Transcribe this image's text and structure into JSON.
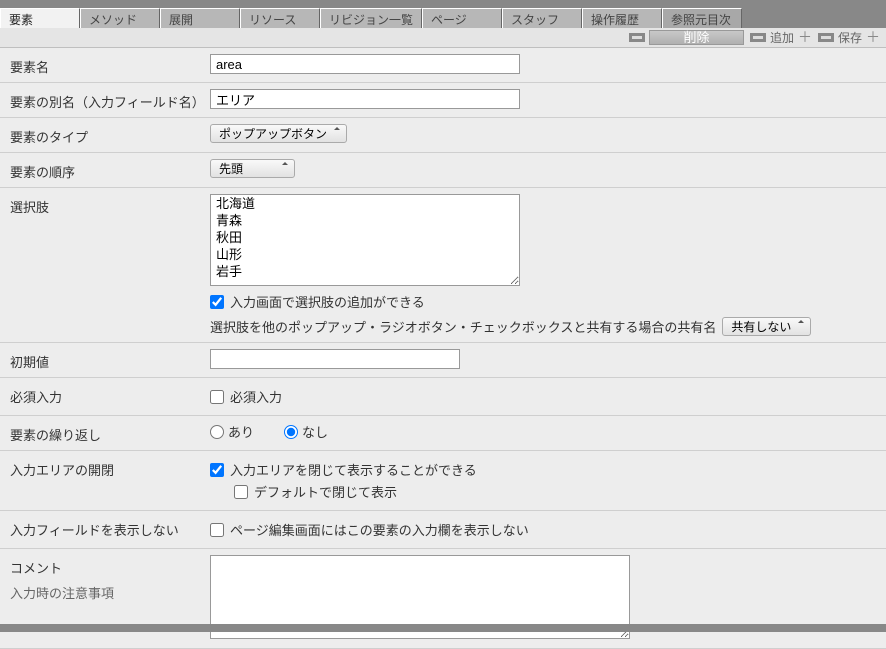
{
  "tabs": [
    {
      "label": "要素",
      "active": true
    },
    {
      "label": "メソッド"
    },
    {
      "label": "展開"
    },
    {
      "label": "リソース"
    },
    {
      "label": "リビジョン一覧"
    },
    {
      "label": "ページ"
    },
    {
      "label": "スタッフ"
    },
    {
      "label": "操作履歴"
    },
    {
      "label": "参照元目次",
      "meta": true
    }
  ],
  "toolbar": {
    "delete": "削除",
    "add": "追加",
    "save": "保存"
  },
  "fields": {
    "name": {
      "label": "要素名",
      "value": "area"
    },
    "alias": {
      "label": "要素の別名（入力フィールド名）",
      "value": "エリア"
    },
    "type": {
      "label": "要素のタイプ",
      "value": "ポップアップボタン"
    },
    "order": {
      "label": "要素の順序",
      "value": "先頭"
    },
    "choices": {
      "label": "選択肢",
      "value": "北海道\n青森\n秋田\n山形\n岩手"
    },
    "choices_add": {
      "checked": true,
      "text": "入力画面で選択肢の追加ができる"
    },
    "choices_share": {
      "text": "選択肢を他のポップアップ・ラジオボタン・チェックボックスと共有する場合の共有名",
      "value": "共有しない"
    },
    "initial": {
      "label": "初期値",
      "value": ""
    },
    "required": {
      "label": "必須入力",
      "text": "必須入力",
      "checked": false
    },
    "repeat": {
      "label": "要素の繰り返し",
      "yes": "あり",
      "no": "なし",
      "value": "no"
    },
    "collapse": {
      "label": "入力エリアの開閉",
      "text": "入力エリアを閉じて表示することができる",
      "checked": true,
      "sub": {
        "text": "デフォルトで閉じて表示",
        "checked": false
      }
    },
    "hide": {
      "label": "入力フィールドを表示しない",
      "text": "ページ編集画面にはこの要素の入力欄を表示しない",
      "checked": false
    },
    "comment": {
      "label": "コメント",
      "sub": "入力時の注意事項",
      "value": ""
    }
  }
}
